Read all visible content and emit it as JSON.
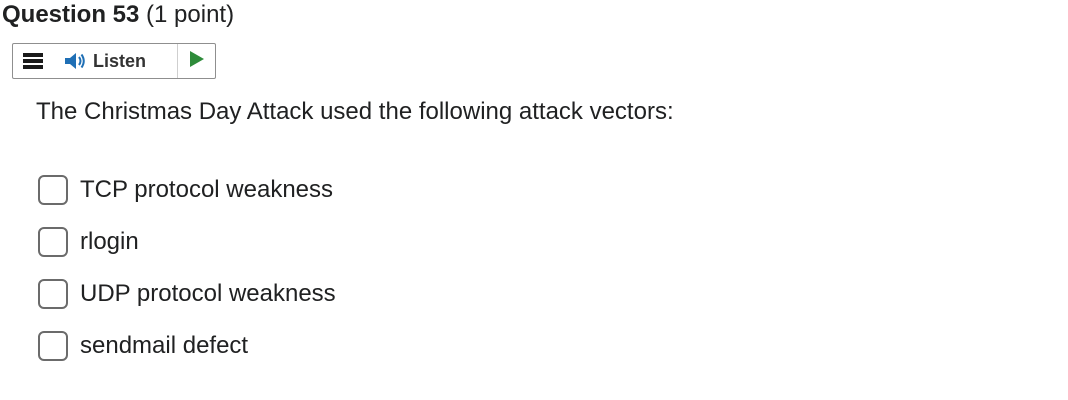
{
  "question": {
    "title": "Question 53",
    "points": "(1 point)",
    "prompt": "The Christmas Day Attack used the following attack vectors:",
    "options": [
      {
        "label": "TCP protocol weakness",
        "checked": false
      },
      {
        "label": "rlogin",
        "checked": false
      },
      {
        "label": "UDP protocol weakness",
        "checked": false
      },
      {
        "label": "sendmail defect",
        "checked": false
      }
    ]
  },
  "toolbar": {
    "menu_icon": "hamburger-menu-icon",
    "listen_icon": "speaker-icon",
    "listen_label": "Listen",
    "play_icon": "play-icon"
  },
  "colors": {
    "speaker_accent": "#1f6fb5",
    "play_green": "#2e8b3a",
    "checkbox_border": "#6b6b6b"
  }
}
